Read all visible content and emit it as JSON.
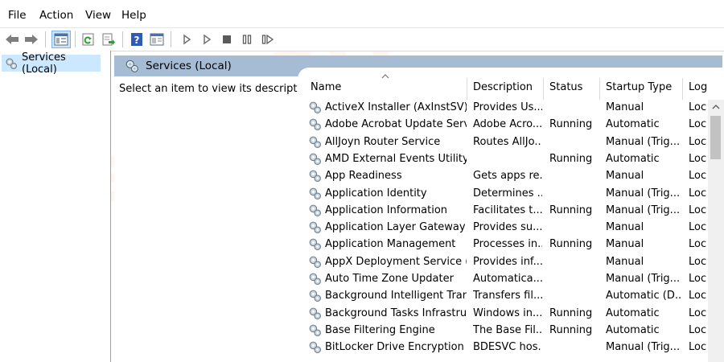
{
  "menu": [
    "File",
    "Action",
    "View",
    "Help"
  ],
  "tree": {
    "root_label": "Services (Local)"
  },
  "banner": {
    "title": "Services (Local)"
  },
  "description_pane": {
    "text": "Select an item to view its description."
  },
  "columns": [
    "Name",
    "Description",
    "Status",
    "Startup Type",
    "Log"
  ],
  "services": [
    {
      "name": "ActiveX Installer (AxInstSV)",
      "description": "Provides Us...",
      "status": "",
      "startup": "Manual",
      "logon": "Loc"
    },
    {
      "name": "Adobe Acrobat Update Serv...",
      "description": "Adobe Acro...",
      "status": "Running",
      "startup": "Automatic",
      "logon": "Loc"
    },
    {
      "name": "AllJoyn Router Service",
      "description": "Routes AllJo...",
      "status": "",
      "startup": "Manual (Trig...",
      "logon": "Loc"
    },
    {
      "name": "AMD External Events Utility",
      "description": "",
      "status": "Running",
      "startup": "Automatic",
      "logon": "Loc"
    },
    {
      "name": "App Readiness",
      "description": "Gets apps re...",
      "status": "",
      "startup": "Manual",
      "logon": "Loc"
    },
    {
      "name": "Application Identity",
      "description": "Determines ...",
      "status": "",
      "startup": "Manual (Trig...",
      "logon": "Loc"
    },
    {
      "name": "Application Information",
      "description": "Facilitates t...",
      "status": "Running",
      "startup": "Manual (Trig...",
      "logon": "Loc"
    },
    {
      "name": "Application Layer Gateway ...",
      "description": "Provides su...",
      "status": "",
      "startup": "Manual",
      "logon": "Loc"
    },
    {
      "name": "Application Management",
      "description": "Processes in...",
      "status": "Running",
      "startup": "Manual",
      "logon": "Loc"
    },
    {
      "name": "AppX Deployment Service (...",
      "description": "Provides inf...",
      "status": "",
      "startup": "Manual",
      "logon": "Loc"
    },
    {
      "name": "Auto Time Zone Updater",
      "description": "Automatica...",
      "status": "",
      "startup": "Manual (Trig...",
      "logon": "Loc"
    },
    {
      "name": "Background Intelligent Tran...",
      "description": "Transfers fil...",
      "status": "",
      "startup": "Automatic (D...",
      "logon": "Loc"
    },
    {
      "name": "Background Tasks Infrastru...",
      "description": "Windows in...",
      "status": "Running",
      "startup": "Automatic",
      "logon": "Loc"
    },
    {
      "name": "Base Filtering Engine",
      "description": "The Base Fil...",
      "status": "Running",
      "startup": "Automatic",
      "logon": "Loc"
    },
    {
      "name": "BitLocker Drive Encryption ...",
      "description": "BDESVC hos...",
      "status": "",
      "startup": "Manual (Trig...",
      "logon": "Loc"
    }
  ],
  "watermark": "DeviceTricks",
  "icons": {
    "back": "back-arrow-icon",
    "forward": "forward-arrow-icon",
    "console": "console-tree-icon",
    "refresh": "refresh-icon",
    "export": "export-list-icon",
    "help": "help-icon",
    "properties": "properties-icon",
    "start": "start-service-icon",
    "start_params": "start-with-params-icon",
    "stop": "stop-service-icon",
    "pause": "pause-service-icon",
    "restart": "restart-service-icon",
    "gear": "gear-icon"
  }
}
